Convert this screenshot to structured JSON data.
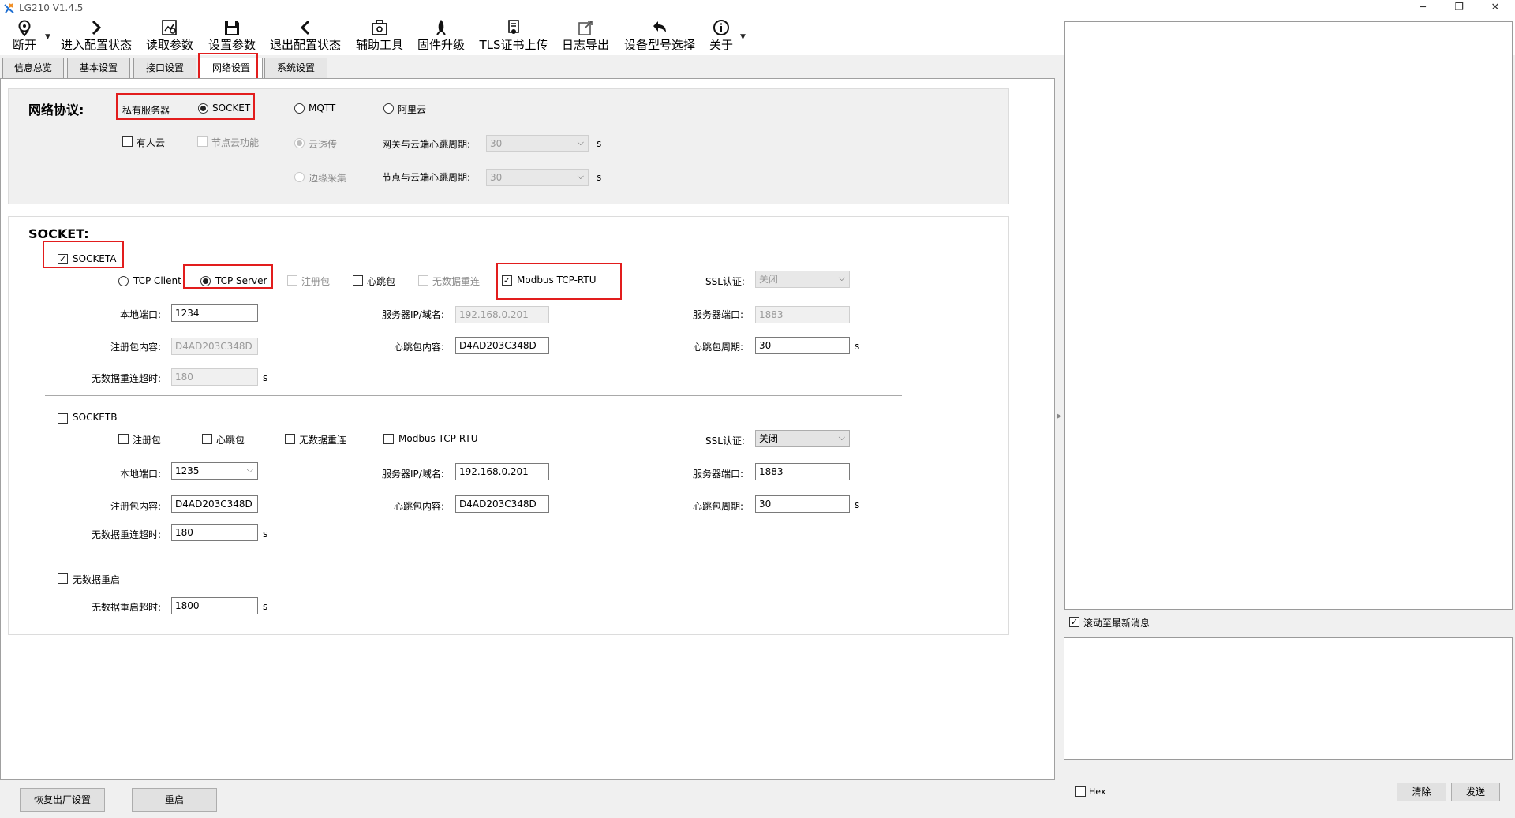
{
  "window": {
    "title": "LG210 V1.4.5",
    "minimize_label": "─",
    "restore_label": "❐",
    "close_label": "✕"
  },
  "toolbar": {
    "items": [
      {
        "label": "断开",
        "icon": "map-pin-icon"
      },
      {
        "label": "进入配置状态",
        "icon": "chevron-right-icon"
      },
      {
        "label": "读取参数",
        "icon": "read-chart-icon"
      },
      {
        "label": "设置参数",
        "icon": "save-icon"
      },
      {
        "label": "退出配置状态",
        "icon": "chevron-left-icon"
      },
      {
        "label": "辅助工具",
        "icon": "toolbox-icon"
      },
      {
        "label": "固件升级",
        "icon": "rocket-icon"
      },
      {
        "label": "TLS证书上传",
        "icon": "certificate-icon"
      },
      {
        "label": "日志导出",
        "icon": "export-icon"
      },
      {
        "label": "设备型号选择",
        "icon": "undo-icon"
      },
      {
        "label": "关于",
        "icon": "info-icon"
      }
    ]
  },
  "tabs": [
    {
      "label": "信息总览"
    },
    {
      "label": "基本设置"
    },
    {
      "label": "接口设置"
    },
    {
      "label": "网络设置",
      "active": true
    },
    {
      "label": "系统设置"
    }
  ],
  "protocol": {
    "header": "网络协议:",
    "private_server_label": "私有服务器",
    "socket_label": "SOCKET",
    "socket_selected": true,
    "mqtt_label": "MQTT",
    "aliyun_label": "阿里云",
    "youren_cloud_label": "有人云",
    "node_cloud_label": "节点云功能",
    "cloud_transparent_label": "云透传",
    "edge_collect_label": "边缘采集",
    "gateway_heartbeat_label": "网关与云端心跳周期:",
    "gateway_heartbeat_value": "30",
    "node_heartbeat_label": "节点与云端心跳周期:",
    "node_heartbeat_value": "30",
    "unit_s": "s"
  },
  "socket": {
    "header": "SOCKET:",
    "socketa": {
      "label": "SOCKETA",
      "checked": true,
      "tcp_client_label": "TCP Client",
      "tcp_server_label": "TCP Server",
      "tcp_server_selected": true,
      "register_label": "注册包",
      "heartbeat_label": "心跳包",
      "heartbeat_checked": false,
      "no_data_reconnect_label": "无数据重连",
      "modbus_label": "Modbus TCP-RTU",
      "modbus_checked": true,
      "ssl_label": "SSL认证:",
      "ssl_value": "关闭",
      "local_port_label": "本地端口:",
      "local_port_value": "1234",
      "server_ip_label": "服务器IP/域名:",
      "server_ip_value": "192.168.0.201",
      "server_port_label": "服务器端口:",
      "server_port_value": "1883",
      "register_content_label": "注册包内容:",
      "register_content_value": "D4AD203C348D",
      "heartbeat_content_label": "心跳包内容:",
      "heartbeat_content_value": "D4AD203C348D",
      "heartbeat_period_label": "心跳包周期:",
      "heartbeat_period_value": "30",
      "reconnect_timeout_label": "无数据重连超时:",
      "reconnect_timeout_value": "180",
      "unit_s": "s"
    },
    "socketb": {
      "label": "SOCKETB",
      "checked": false,
      "register_label": "注册包",
      "heartbeat_label": "心跳包",
      "no_data_reconnect_label": "无数据重连",
      "modbus_label": "Modbus TCP-RTU",
      "ssl_label": "SSL认证:",
      "ssl_value": "关闭",
      "local_port_label": "本地端口:",
      "local_port_value": "1235",
      "server_ip_label": "服务器IP/域名:",
      "server_ip_value": "192.168.0.201",
      "server_port_label": "服务器端口:",
      "server_port_value": "1883",
      "register_content_label": "注册包内容:",
      "register_content_value": "D4AD203C348D",
      "heartbeat_content_label": "心跳包内容:",
      "heartbeat_content_value": "D4AD203C348D",
      "heartbeat_period_label": "心跳包周期:",
      "heartbeat_period_value": "30",
      "reconnect_timeout_label": "无数据重连超时:",
      "reconnect_timeout_value": "180",
      "unit_s": "s"
    },
    "restart": {
      "label": "无数据重启",
      "checked": false,
      "timeout_label": "无数据重启超时:",
      "timeout_value": "1800",
      "unit_s": "s"
    }
  },
  "bottom_buttons": {
    "factory_reset": "恢复出厂设置",
    "reboot": "重启"
  },
  "log_panel": {
    "scroll_latest_label": "滚动至最新消息",
    "scroll_latest_checked": true,
    "hex_label": "Hex",
    "hex_checked": false,
    "clear_label": "清除",
    "send_label": "发送"
  }
}
